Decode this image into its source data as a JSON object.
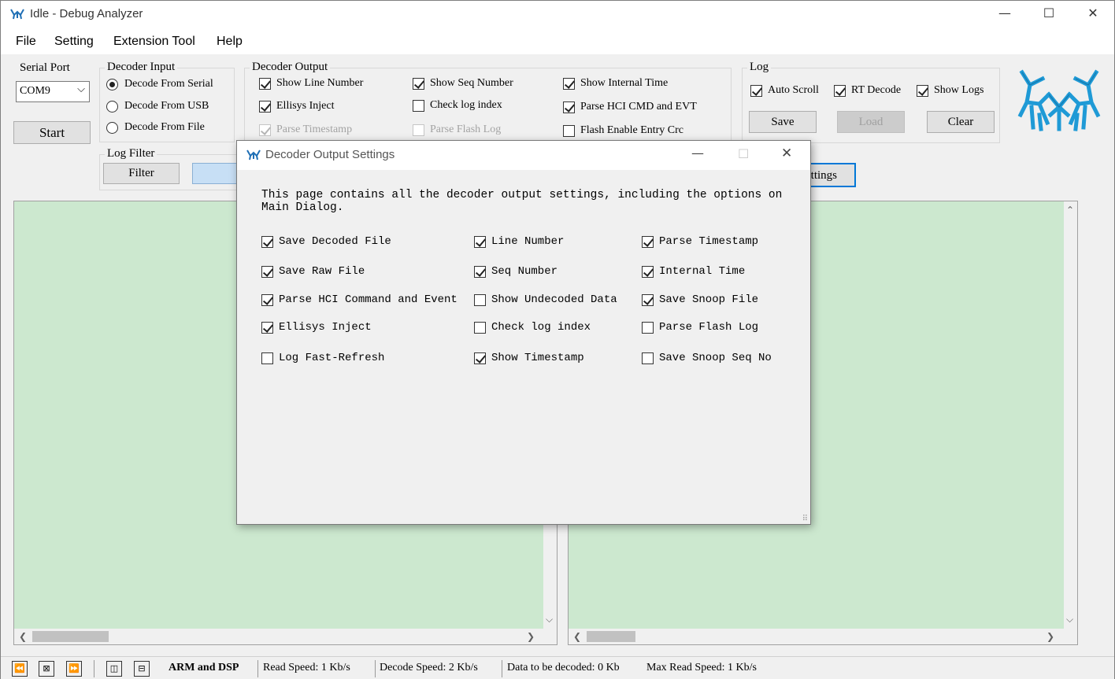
{
  "window": {
    "title": "Idle - Debug Analyzer",
    "minimize": "—",
    "maximize": "☐",
    "close": "✕"
  },
  "menu": [
    "File",
    "Setting",
    "Extension Tool",
    "Help"
  ],
  "serial_port": {
    "title": "Serial Port",
    "selected": "COM9",
    "start_label": "Start"
  },
  "decoder_input": {
    "title": "Decoder Input",
    "options": [
      "Decode From Serial",
      "Decode From USB",
      "Decode From File"
    ],
    "selected_index": 0
  },
  "decoder_output": {
    "title": "Decoder Output",
    "items": [
      {
        "label": "Show Line Number",
        "checked": true,
        "enabled": true
      },
      {
        "label": "Show Seq Number",
        "checked": true,
        "enabled": true
      },
      {
        "label": "Show Internal Time",
        "checked": true,
        "enabled": true
      },
      {
        "label": "Ellisys Inject",
        "checked": true,
        "enabled": true
      },
      {
        "label": "Check log index",
        "checked": false,
        "enabled": true
      },
      {
        "label": "Parse HCI CMD and EVT",
        "checked": true,
        "enabled": true
      },
      {
        "label": "Parse Timestamp",
        "checked": true,
        "enabled": false
      },
      {
        "label": "Parse Flash Log",
        "checked": false,
        "enabled": false
      },
      {
        "label": "Flash Enable Entry Crc",
        "checked": false,
        "enabled": true
      }
    ]
  },
  "log": {
    "title": "Log",
    "auto_scroll": "Auto Scroll",
    "rt_decode": "RT Decode",
    "show_logs": "Show Logs",
    "save_label": "Save",
    "load_label": "Load",
    "clear_label": "Clear"
  },
  "log_filter": {
    "title": "Log Filter",
    "filter_label": "Filter"
  },
  "settings_button_partial": "ttings",
  "status": {
    "mode": "ARM and DSP",
    "read_speed": "Read Speed:  1 Kb/s",
    "decode_speed": "Decode Speed:  2 Kb/s",
    "data_to_decode": "Data to be decoded:  0 Kb",
    "max_read_speed": "Max Read Speed:  1 Kb/s"
  },
  "dialog": {
    "title": "Decoder Output Settings",
    "description": "This page contains all the decoder output settings, including the options on Main Dialog.",
    "options": [
      {
        "label": "Save Decoded File",
        "checked": true
      },
      {
        "label": "Line Number",
        "checked": true
      },
      {
        "label": "Parse Timestamp",
        "checked": true
      },
      {
        "label": "Save Raw File",
        "checked": true
      },
      {
        "label": "Seq Number",
        "checked": true
      },
      {
        "label": "Internal Time",
        "checked": true
      },
      {
        "label": "Parse HCI Command and Event",
        "checked": true
      },
      {
        "label": "Show Undecoded Data",
        "checked": false
      },
      {
        "label": "Save Snoop File",
        "checked": true
      },
      {
        "label": "Ellisys Inject",
        "checked": true
      },
      {
        "label": "Check log index",
        "checked": false
      },
      {
        "label": "Parse Flash Log",
        "checked": false
      },
      {
        "label": "Log Fast-Refresh",
        "checked": false
      },
      {
        "label": "Show Timestamp",
        "checked": true
      },
      {
        "label": "Save Snoop Seq No",
        "checked": false
      }
    ]
  },
  "colors": {
    "log_pane_bg": "#cce8cf",
    "logo_blue": "#1f9ad6",
    "focus_border": "#0078d7"
  },
  "icons": [
    "app-logo-icon",
    "minimize-icon",
    "maximize-icon",
    "close-icon",
    "chevron-down-icon",
    "brand-logo-icon",
    "first-page-icon",
    "stop-icon",
    "last-page-icon",
    "split-vertical-icon",
    "split-horizontal-icon",
    "resize-grip-icon"
  ]
}
